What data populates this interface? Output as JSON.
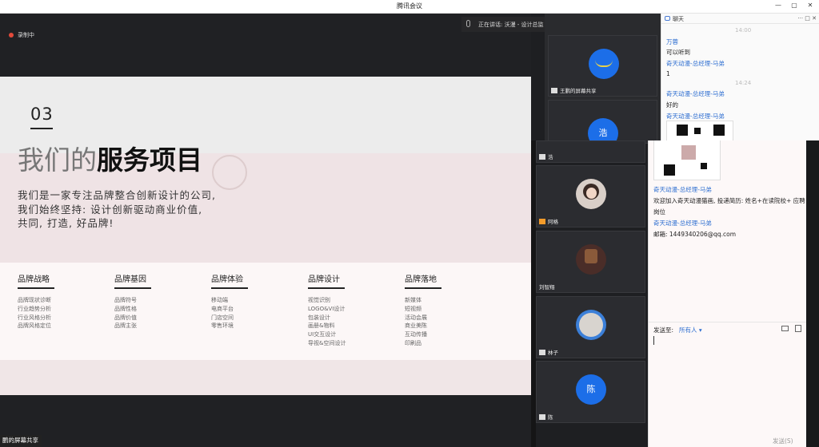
{
  "window": {
    "title": "腾讯会议",
    "controls": [
      "—",
      "▢",
      "✕"
    ]
  },
  "recording": {
    "label": "录制中"
  },
  "speaking": {
    "label": "正在讲话: 沃漫 - 设计总监 - 王..."
  },
  "slide": {
    "number": "03",
    "heading_light": "我们的",
    "heading_bold": "服务项目",
    "intro": [
      "我们是一家专注品牌整合创新设计的公司,",
      "我们始终坚持: 设计创新驱动商业价值,",
      "共同, 打造, 好品牌!"
    ],
    "columns": [
      {
        "title": "品牌战略",
        "items": [
          "品牌现状诊断",
          "行业趋势分析",
          "行业风格分析",
          "品牌风格定位"
        ]
      },
      {
        "title": "品牌基因",
        "items": [
          "品牌符号",
          "品牌性格",
          "品牌价值",
          "品牌主张"
        ]
      },
      {
        "title": "品牌体验",
        "items": [
          "移动端",
          "电商平台",
          "门店空间",
          "零售环境"
        ]
      },
      {
        "title": "品牌设计",
        "items": [
          "视觉识别",
          "LOGO&VI设计",
          "包装设计",
          "画册&物料",
          "UI交互设计",
          "导视&空间设计"
        ]
      },
      {
        "title": "品牌落地",
        "items": [
          "新媒体",
          "短视频",
          "活动会展",
          "商业美陈",
          "互动传播",
          "印刷品"
        ]
      }
    ]
  },
  "share_label": "鹏的屏幕共享",
  "participants": [
    {
      "name": "王鹏的屏幕共享",
      "type": "share"
    },
    {
      "name": "浩",
      "letter": "浩",
      "color": "#1c6ee8"
    },
    {
      "name": "浩",
      "letter": "",
      "color": "#1c6ee8"
    },
    {
      "name": "阿格",
      "type": "photo"
    },
    {
      "name": "刘智翔",
      "type": "photo"
    },
    {
      "name": "林子",
      "type": "photo"
    },
    {
      "name": "陈",
      "letter": "陈",
      "color": "#1c6ee8"
    }
  ],
  "chat": {
    "title": "聊天",
    "header_icons": "··· □ ✕",
    "messages_top": [
      {
        "time": "14:00"
      },
      {
        "sender": "万蓉",
        "text": "可以听到"
      },
      {
        "sender": "奇天动漫-总经理-马弟",
        "text": "1"
      },
      {
        "time": "14:24"
      },
      {
        "sender": "奇天动漫-总经理-马弟",
        "text": "好的"
      },
      {
        "sender": "奇天动漫-总经理-马弟"
      }
    ],
    "messages_bottom": [
      {
        "sender": "奇天动漫-总经理-马弟",
        "text": "欢迎加入奇天动漫猫画, 投递简历: 姓名+在读院校+ 应聘",
        "text2": "岗位"
      },
      {
        "sender": "奇天动漫-总经理-马弟",
        "text": "邮箱: 1449340206@qq.com"
      }
    ],
    "send_to_label": "发送至:",
    "send_to_value": "所有人",
    "send_button": "发送(S)"
  }
}
